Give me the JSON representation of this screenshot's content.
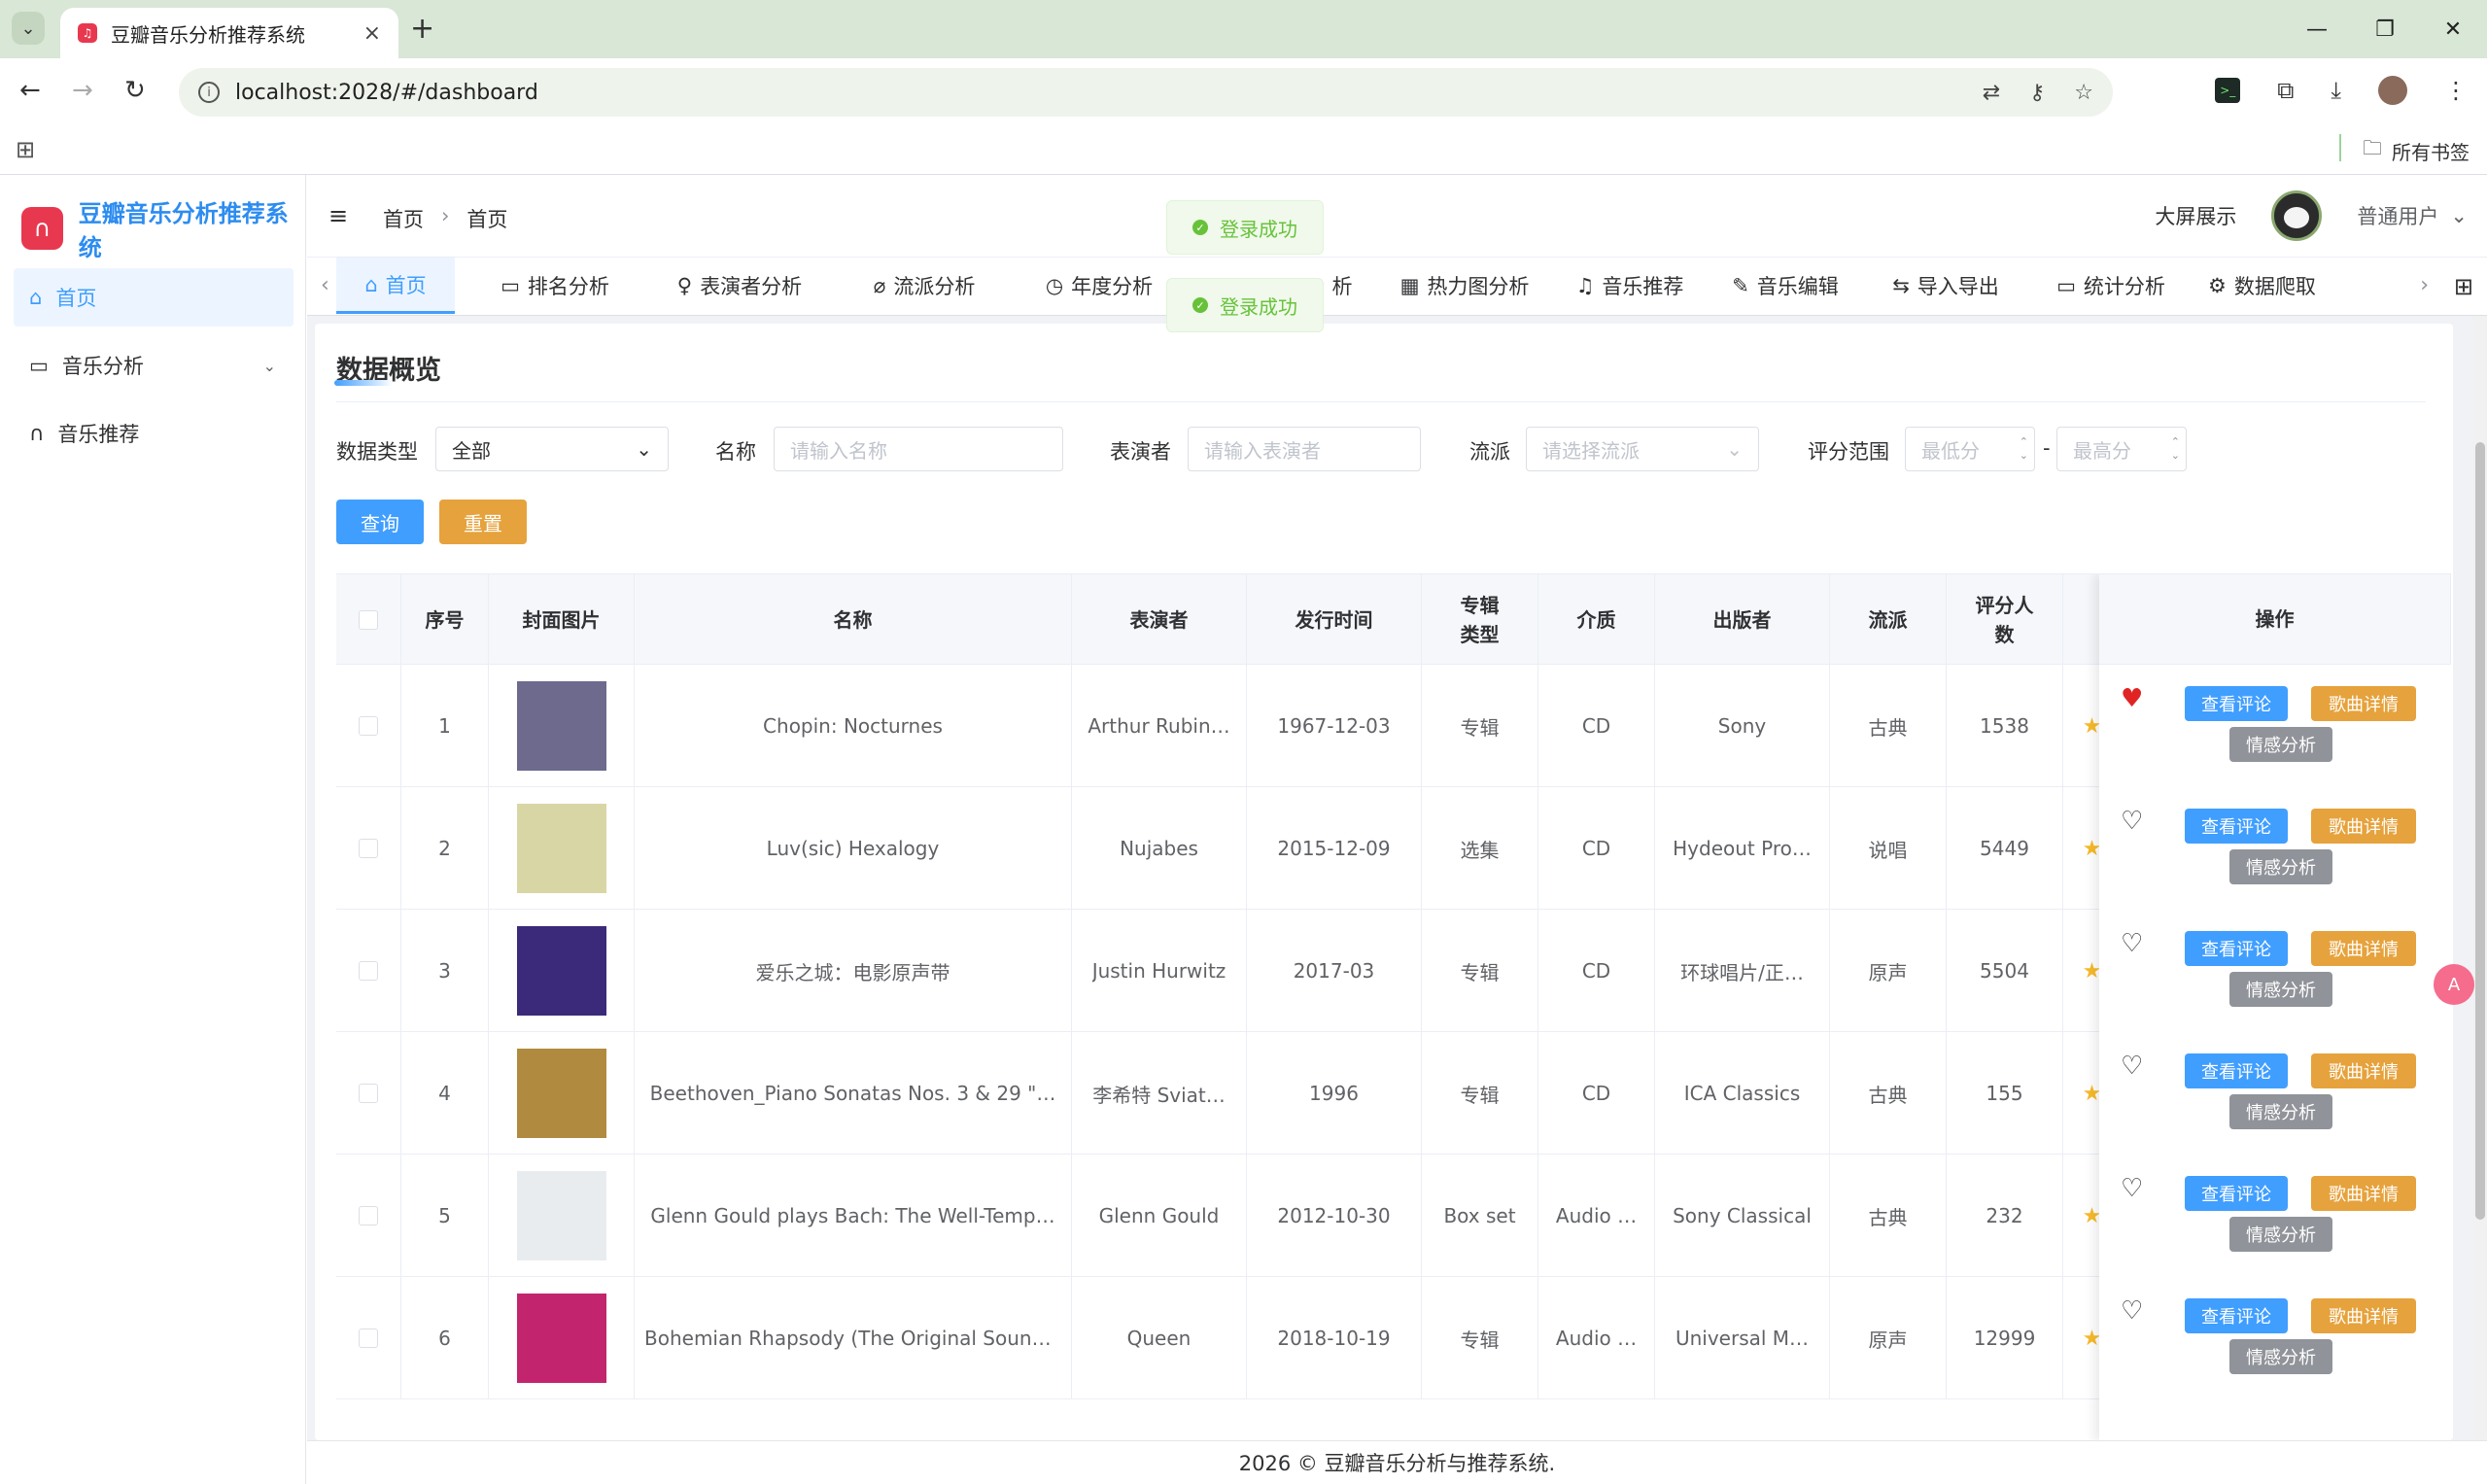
{
  "browser": {
    "tab_title": "豆瓣音乐分析推荐系统",
    "url": "localhost:2028/#/dashboard",
    "bookmarks_all": "所有书签"
  },
  "app": {
    "logo_text": "豆瓣音乐分析推荐系统",
    "sidebar": [
      {
        "label": "首页",
        "icon": "home-icon",
        "active": true
      },
      {
        "label": "音乐分析",
        "icon": "chart-icon",
        "has_submenu": true
      },
      {
        "label": "音乐推荐",
        "icon": "headphones-icon"
      }
    ],
    "breadcrumb": [
      "首页",
      "首页"
    ],
    "header_right": {
      "big_screen": "大屏展示",
      "user": "普通用户"
    },
    "tags": [
      {
        "label": "首页",
        "icon": "⌂",
        "active": true
      },
      {
        "label": "排名分析",
        "icon": "▭"
      },
      {
        "label": "表演者分析",
        "icon": "♀"
      },
      {
        "label": "流派分析",
        "icon": "⌀"
      },
      {
        "label": "年度分析",
        "icon": "◷"
      },
      {
        "label": "析",
        "icon": ""
      },
      {
        "label": "热力图分析",
        "icon": "▦"
      },
      {
        "label": "音乐推荐",
        "icon": "♫"
      },
      {
        "label": "音乐编辑",
        "icon": "✎"
      },
      {
        "label": "导入导出",
        "icon": "⇆"
      },
      {
        "label": "统计分析",
        "icon": "▭"
      },
      {
        "label": "数据爬取",
        "icon": "⚙"
      }
    ],
    "toasts": [
      "登录成功",
      "登录成功"
    ]
  },
  "card": {
    "title": "数据概览",
    "filters": {
      "type_label": "数据类型",
      "type_value": "全部",
      "name_label": "名称",
      "name_placeholder": "请输入名称",
      "performer_label": "表演者",
      "performer_placeholder": "请输入表演者",
      "genre_label": "流派",
      "genre_placeholder": "请选择流派",
      "score_label": "评分范围",
      "min_placeholder": "最低分",
      "max_placeholder": "最高分",
      "range_dash": "-"
    },
    "buttons": {
      "query": "查询",
      "reset": "重置"
    }
  },
  "table": {
    "headers": [
      "序号",
      "封面图片",
      "名称",
      "表演者",
      "发行时间",
      "专辑类型",
      "介质",
      "出版者",
      "流派",
      "评分人数",
      "操作"
    ],
    "rows": [
      {
        "idx": "1",
        "name": "Chopin: Nocturnes",
        "performer": "Arthur Rubin…",
        "date": "1967-12-03",
        "album_type": "专辑",
        "medium": "CD",
        "publisher": "Sony",
        "genre": "古典",
        "raters": "1538",
        "liked": true,
        "cover_color": "#6d6a8e"
      },
      {
        "idx": "2",
        "name": "Luv(sic) Hexalogy",
        "performer": "Nujabes",
        "date": "2015-12-09",
        "album_type": "选集",
        "medium": "CD",
        "publisher": "Hydeout Pro…",
        "genre": "说唱",
        "raters": "5449",
        "liked": false,
        "cover_color": "#d9d6a6"
      },
      {
        "idx": "3",
        "name": "爱乐之城：电影原声带",
        "performer": "Justin Hurwitz",
        "date": "2017-03",
        "album_type": "专辑",
        "medium": "CD",
        "publisher": "环球唱片/正…",
        "genre": "原声",
        "raters": "5504",
        "liked": false,
        "cover_color": "#3b2a7a"
      },
      {
        "idx": "4",
        "name": "Beethoven_Piano Sonatas Nos. 3 & 29 \"…",
        "performer": "李希特 Sviat…",
        "date": "1996",
        "album_type": "专辑",
        "medium": "CD",
        "publisher": "ICA Classics",
        "genre": "古典",
        "raters": "155",
        "liked": false,
        "cover_color": "#b08a3e"
      },
      {
        "idx": "5",
        "name": "Glenn Gould plays Bach: The Well-Temp…",
        "performer": "Glenn Gould",
        "date": "2012-10-30",
        "album_type": "Box set",
        "medium": "Audio …",
        "publisher": "Sony Classical",
        "genre": "古典",
        "raters": "232",
        "liked": false,
        "cover_color": "#e9ecef"
      },
      {
        "idx": "6",
        "name": "Bohemian Rhapsody (The Original Sound…",
        "performer": "Queen",
        "date": "2018-10-19",
        "album_type": "专辑",
        "medium": "Audio …",
        "publisher": "Universal M…",
        "genre": "原声",
        "raters": "12999",
        "liked": false,
        "cover_color": "#c2256d"
      }
    ],
    "ops": {
      "comments": "查看评论",
      "details": "歌曲详情",
      "sentiment": "情感分析"
    }
  },
  "footer": "2026 © 豆瓣音乐分析与推荐系统."
}
